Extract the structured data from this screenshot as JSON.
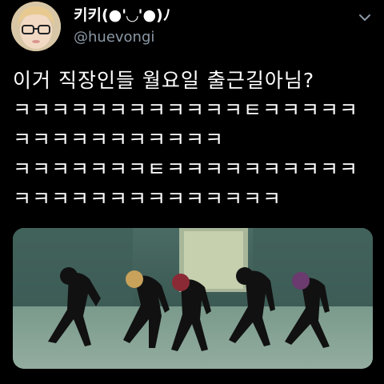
{
  "author": {
    "display_name": "키키(●'◡'●)ﾉ",
    "handle": "@huevongi"
  },
  "icons": {
    "more": "chevron-down-icon",
    "avatar": "profile-photo"
  },
  "tweet": {
    "lines": [
      "이거 직장인들 월요일 출근길아님?",
      "ㅋㅋㅋㅋㅋㅋㅋㅋㅋㅋㅋㅋㅌㅋㅋㅋㅋㅋ",
      "ㅋㅋㅋㅋㅋㅋㅋㅋㅋㅋㅋ",
      "ㅋㅋㅋㅋㅋㅋㅋㅌㅋㅋㅋㅋㅋㅋㅋㅋㅋㅋ",
      "ㅋㅋㅋㅋㅋㅋㅋㅋㅋㅋㅋㅋㅋㅋ"
    ]
  },
  "colors": {
    "background": "#000000",
    "text": "#ffffff",
    "secondary": "#8b98a5"
  }
}
